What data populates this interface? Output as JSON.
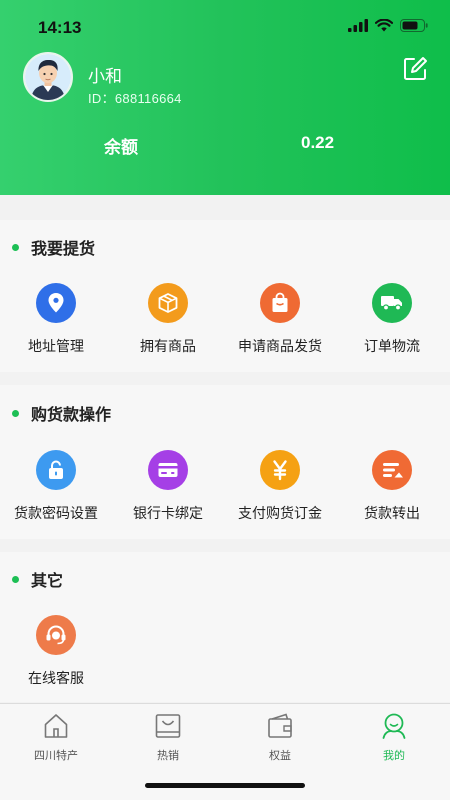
{
  "status_bar": {
    "time": "14:13"
  },
  "profile": {
    "name": "小和",
    "id_text": "ID：688116664"
  },
  "balance": {
    "label": "余额",
    "value": "0.22"
  },
  "sections": [
    {
      "title": "我要提货",
      "items": [
        {
          "label": "地址管理",
          "icon": "location-pin-icon",
          "color": "#2f6fe8"
        },
        {
          "label": "拥有商品",
          "icon": "box-icon",
          "color": "#f39b1c"
        },
        {
          "label": "申请商品发货",
          "icon": "bag-icon",
          "color": "#ef6a33"
        },
        {
          "label": "订单物流",
          "icon": "truck-icon",
          "color": "#1fb955"
        }
      ]
    },
    {
      "title": "购货款操作",
      "items": [
        {
          "label": "货款密码设置",
          "icon": "lock-icon",
          "color": "#3d9af0"
        },
        {
          "label": "银行卡绑定",
          "icon": "card-icon",
          "color": "#a53fe6"
        },
        {
          "label": "支付购货订金",
          "icon": "yen-icon",
          "color": "#f5a113"
        },
        {
          "label": "货款转出",
          "icon": "transfer-icon",
          "color": "#f06a34"
        }
      ]
    },
    {
      "title": "其它",
      "items": [
        {
          "label": "在线客服",
          "icon": "headset-icon",
          "color": "#ee7b4a"
        }
      ]
    }
  ],
  "tabbar": {
    "tabs": [
      {
        "label": "四川特产",
        "icon": "home-icon",
        "active": false
      },
      {
        "label": "热销",
        "icon": "shopping-bag-icon",
        "active": false
      },
      {
        "label": "权益",
        "icon": "wallet-icon",
        "active": false
      },
      {
        "label": "我的",
        "icon": "profile-icon",
        "active": true
      }
    ],
    "active_color": "#1fb955"
  },
  "colors": {
    "header_start": "#35d06e",
    "header_end": "#0fbe4a",
    "accent_dot": "#1dbf55"
  }
}
